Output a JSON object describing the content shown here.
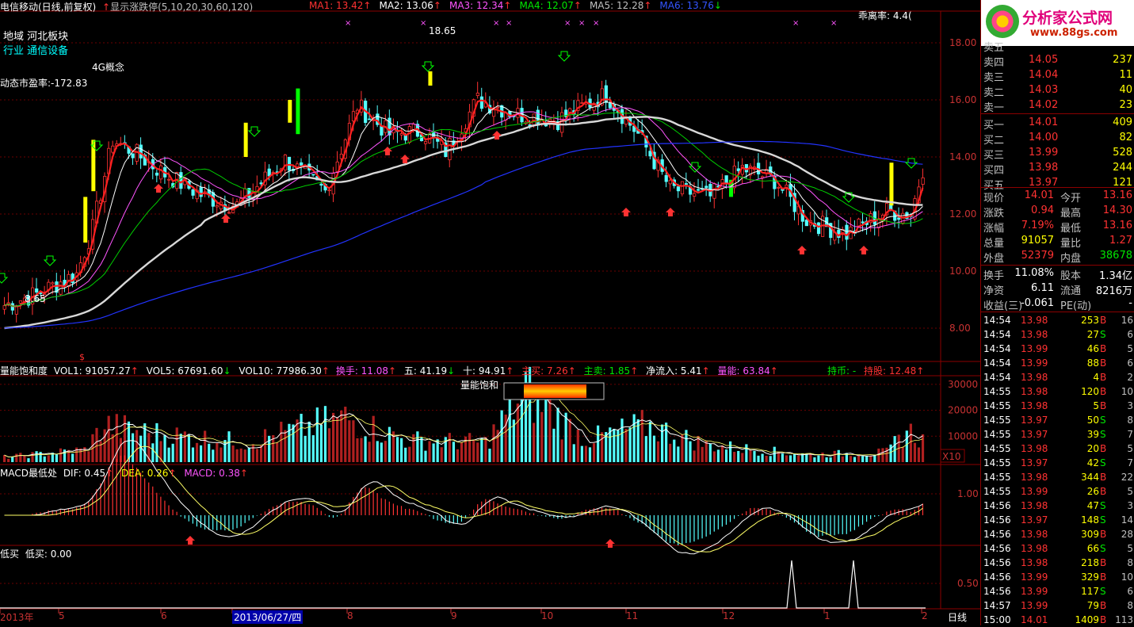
{
  "header": {
    "stock_title": "电信移动(日线,前复权)",
    "limit_label": "显示涨跌停(5,10,20,30,60,120)",
    "ma": [
      {
        "label": "MA1: 13.42",
        "color": "#ff3232"
      },
      {
        "label": "MA2: 13.06",
        "color": "#ffffff"
      },
      {
        "label": "MA3: 12.34",
        "color": "#ff55ff"
      },
      {
        "label": "MA4: 12.07",
        "color": "#00e600"
      },
      {
        "label": "MA5: 12.28",
        "color": "#c0c0c0"
      },
      {
        "label": "MA6: 13.76",
        "color": "#3355ff"
      }
    ],
    "deviation": "乖离率: 4.4("
  },
  "annotations": {
    "region": "地域 河北板块",
    "industry": "行业 通信设备",
    "concept": "4G概念",
    "pe": "动态市盈率:-172.83",
    "high_label": "18.65",
    "low_label": "8.65"
  },
  "price_axis": [
    "18.00",
    "16.00",
    "14.00",
    "12.00",
    "10.00",
    "8.00"
  ],
  "volume_header": {
    "name": "量能饱和度",
    "vol1": "VOL1: 91057.27",
    "vol5": "VOL5: 67691.60",
    "vol10": "VOL10: 77986.30",
    "turnover": "换手: 11.08",
    "five": "五: 41.19",
    "ten": "十: 94.91",
    "main_buy": "主买: 7.26",
    "main_sell": "主卖: 1.85",
    "net_inflow": "净流入: 5.41",
    "energy": "量能: 63.84",
    "hold_cash": "持币: -",
    "hold_stock": "持股: 12.48",
    "saturation_label": "量能饱和"
  },
  "volume_axis": [
    "30000",
    "20000",
    "10000"
  ],
  "volume_unit": "X10",
  "macd_header": {
    "name": "MACD最低处",
    "dif": "DIF: 0.45",
    "dea": "DEA: 0.26",
    "macd": "MACD: 0.38"
  },
  "macd_axis": [
    "1.00"
  ],
  "lowbuy_header": {
    "name": "低买",
    "value": "低买: 0.00"
  },
  "lowbuy_axis": [
    "0.50"
  ],
  "date_axis": [
    {
      "label": "2013年"
    },
    {
      "label": "5"
    },
    {
      "label": "6"
    },
    {
      "label": "2013/06/27/四"
    },
    {
      "label": "8"
    },
    {
      "label": "9"
    },
    {
      "label": "10"
    },
    {
      "label": "11"
    },
    {
      "label": "12"
    },
    {
      "label": "1"
    },
    {
      "label": "2"
    }
  ],
  "period_label": "日线",
  "logo": {
    "title": "分析家公式网",
    "url": "www.88gs.com"
  },
  "orderbook": [
    {
      "label": "卖五",
      "price": "",
      "vol": ""
    },
    {
      "label": "卖四",
      "price": "14.05",
      "vol": "237"
    },
    {
      "label": "卖三",
      "price": "14.04",
      "vol": "11"
    },
    {
      "label": "卖二",
      "price": "14.03",
      "vol": "40"
    },
    {
      "label": "卖一",
      "price": "14.02",
      "vol": "23"
    },
    {
      "label": "买一",
      "price": "14.01",
      "vol": "409"
    },
    {
      "label": "买二",
      "price": "14.00",
      "vol": "82"
    },
    {
      "label": "买三",
      "price": "13.99",
      "vol": "528"
    },
    {
      "label": "买四",
      "price": "13.98",
      "vol": "244"
    },
    {
      "label": "买五",
      "price": "13.97",
      "vol": "121"
    }
  ],
  "quote": [
    {
      "l1": "现价",
      "v1": "14.01",
      "c1": "#ff3232",
      "l2": "今开",
      "v2": "13.16",
      "c2": "#ff3232"
    },
    {
      "l1": "涨跌",
      "v1": "0.94",
      "c1": "#ff3232",
      "l2": "最高",
      "v2": "14.30",
      "c2": "#ff3232"
    },
    {
      "l1": "涨幅",
      "v1": "7.19%",
      "c1": "#ff3232",
      "l2": "最低",
      "v2": "13.16",
      "c2": "#ff3232"
    },
    {
      "l1": "总量",
      "v1": "91057",
      "c1": "#ffff00",
      "l2": "量比",
      "v2": "1.27",
      "c2": "#ff3232"
    },
    {
      "l1": "外盘",
      "v1": "52379",
      "c1": "#ff3232",
      "l2": "内盘",
      "v2": "38678",
      "c2": "#00e600"
    }
  ],
  "fund": [
    {
      "l1": "换手",
      "v1": "11.08%",
      "l2": "股本",
      "v2": "1.34亿"
    },
    {
      "l1": "净资",
      "v1": "6.11",
      "l2": "流通",
      "v2": "8216万"
    },
    {
      "l1": "收益(三)",
      "v1": "-0.061",
      "l2": "PE(动)",
      "v2": "-"
    }
  ],
  "ticks": [
    {
      "t": "14:54",
      "p": "13.98",
      "v": "253",
      "d": "B",
      "n": "16"
    },
    {
      "t": "14:54",
      "p": "13.98",
      "v": "27",
      "d": "S",
      "n": "6"
    },
    {
      "t": "14:54",
      "p": "13.99",
      "v": "46",
      "d": "B",
      "n": "5"
    },
    {
      "t": "14:54",
      "p": "13.99",
      "v": "88",
      "d": "B",
      "n": "6"
    },
    {
      "t": "14:54",
      "p": "13.98",
      "v": "4",
      "d": "B",
      "n": "2"
    },
    {
      "t": "14:55",
      "p": "13.98",
      "v": "120",
      "d": "B",
      "n": "10"
    },
    {
      "t": "14:55",
      "p": "13.98",
      "v": "5",
      "d": "B",
      "n": "3"
    },
    {
      "t": "14:55",
      "p": "13.97",
      "v": "50",
      "d": "S",
      "n": "8"
    },
    {
      "t": "14:55",
      "p": "13.97",
      "v": "39",
      "d": "S",
      "n": "7"
    },
    {
      "t": "14:55",
      "p": "13.98",
      "v": "20",
      "d": "B",
      "n": "5"
    },
    {
      "t": "14:55",
      "p": "13.97",
      "v": "42",
      "d": "S",
      "n": "7"
    },
    {
      "t": "14:55",
      "p": "13.98",
      "v": "344",
      "d": "B",
      "n": "22"
    },
    {
      "t": "14:55",
      "p": "13.99",
      "v": "26",
      "d": "B",
      "n": "5"
    },
    {
      "t": "14:56",
      "p": "13.98",
      "v": "47",
      "d": "S",
      "n": "3"
    },
    {
      "t": "14:56",
      "p": "13.97",
      "v": "148",
      "d": "S",
      "n": "14"
    },
    {
      "t": "14:56",
      "p": "13.98",
      "v": "309",
      "d": "B",
      "n": "28"
    },
    {
      "t": "14:56",
      "p": "13.98",
      "v": "66",
      "d": "S",
      "n": "5"
    },
    {
      "t": "14:56",
      "p": "13.98",
      "v": "218",
      "d": "B",
      "n": "8"
    },
    {
      "t": "14:56",
      "p": "13.99",
      "v": "329",
      "d": "B",
      "n": "10"
    },
    {
      "t": "14:56",
      "p": "13.99",
      "v": "117",
      "d": "S",
      "n": "6"
    },
    {
      "t": "14:57",
      "p": "13.99",
      "v": "79",
      "d": "B",
      "n": "8"
    },
    {
      "t": "15:00",
      "p": "14.01",
      "v": "1409",
      "d": "B",
      "n": "113"
    }
  ]
}
